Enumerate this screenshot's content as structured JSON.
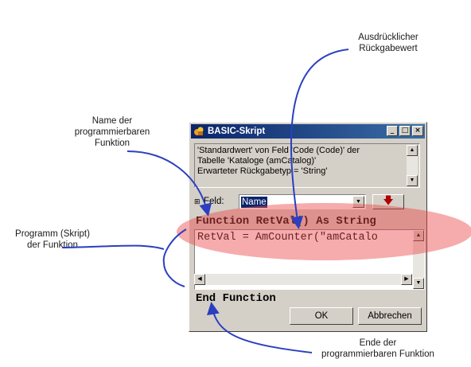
{
  "annotations": {
    "return_value": [
      "Ausdrücklicher",
      "Rückgabewert"
    ],
    "function_name": [
      "Name der",
      "programmierbaren",
      "Funktion"
    ],
    "program": [
      "Programm (Skript)",
      "der Funktion"
    ],
    "end": [
      "Ende der",
      "programmierbaren Funktion"
    ]
  },
  "dialog": {
    "title": "BASIC-Skript",
    "title_buttons": [
      "_",
      "□",
      "×"
    ],
    "description_lines": [
      "'Standardwert' von Feld 'Code (Code)' der",
      "Tabelle 'Kataloge (amCatalog)'",
      "Erwarteter Rückgabetyp = 'String'"
    ],
    "field_label": "Feld:",
    "field_value": "Name",
    "function_header": "Function RetVal() As String",
    "script_line": "RetVal = AmCounter(\"amCatalo",
    "function_end": "End Function",
    "ok_label": "OK",
    "cancel_label": "Abbrechen"
  },
  "colors": {
    "title_start": "#0a246a",
    "title_end": "#3a6ea5",
    "dialog_bg": "#d4d0c8",
    "highlight": "#eb4646",
    "arrow": "#2b3fc0",
    "down_arrow": "#b00000"
  },
  "icons": {
    "title": "basic-script-icon",
    "field": "field-tree-icon",
    "insert": "insert-arrow-down-icon"
  }
}
